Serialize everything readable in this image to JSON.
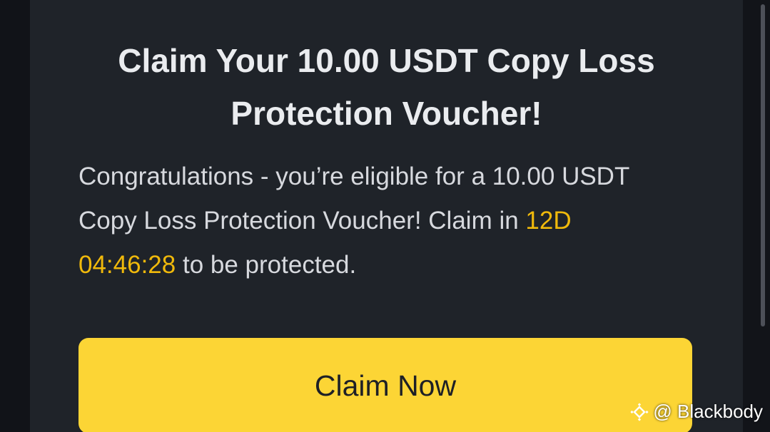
{
  "modal": {
    "title_line1": "Claim Your 10.00 USDT Copy Loss",
    "title_line2": "Protection Voucher!",
    "body": {
      "line1": "Congratulations - you’re eligible for a 10.00 USDT",
      "line2_prefix": "Copy Loss Protection Voucher! Claim in ",
      "countdown_days": "12D",
      "countdown_time": "04:46:28",
      "line3_suffix": " to be protected."
    },
    "claim_button_label": "Claim Now"
  },
  "watermark": {
    "icon": "binance-square-logo-icon",
    "handle": "@ Blackbody"
  },
  "colors": {
    "modal_background": "#1f2329",
    "accent_yellow": "#fcd535",
    "highlight_text": "#f0b90b",
    "title_text": "#eaecef",
    "body_text": "#d7d9de"
  }
}
